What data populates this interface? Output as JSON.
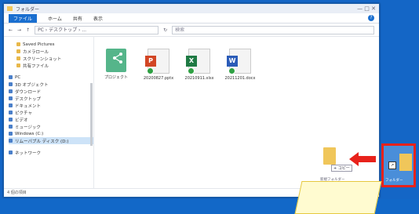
{
  "window": {
    "title": "フォルダー",
    "controls": "—  □  ✕"
  },
  "ribbon": {
    "tabs": [
      "ファイル",
      "ホーム",
      "共有",
      "表示"
    ]
  },
  "address": {
    "path": "PC › デスクトップ › ...",
    "search_placeholder": "検索"
  },
  "sidebar": {
    "items": [
      {
        "label": "Saved Pictures",
        "indent": true,
        "color": "#e8b84a"
      },
      {
        "label": "カメラロール",
        "indent": true,
        "color": "#e8b84a"
      },
      {
        "label": "スクリーンショット",
        "indent": true,
        "color": "#e8b84a"
      },
      {
        "label": "共有ファイル",
        "indent": true,
        "color": "#e8b84a"
      },
      {
        "label": "PC",
        "indent": false,
        "color": "#4a7fc9",
        "gap": true
      },
      {
        "label": "3D オブジェクト",
        "indent": false,
        "color": "#4a7fc9"
      },
      {
        "label": "ダウンロード",
        "indent": false,
        "color": "#4a7fc9"
      },
      {
        "label": "デスクトップ",
        "indent": false,
        "color": "#4a7fc9"
      },
      {
        "label": "ドキュメント",
        "indent": false,
        "color": "#4a7fc9"
      },
      {
        "label": "ピクチャ",
        "indent": false,
        "color": "#4a7fc9"
      },
      {
        "label": "ビデオ",
        "indent": false,
        "color": "#4a7fc9"
      },
      {
        "label": "ミュージック",
        "indent": false,
        "color": "#4a7fc9"
      },
      {
        "label": "Windows (C:)",
        "indent": false,
        "color": "#4a7fc9"
      },
      {
        "label": "リムーバブル ディスク (D:)",
        "indent": false,
        "color": "#4a7fc9",
        "selected": true
      },
      {
        "label": "ネットワーク",
        "indent": false,
        "color": "#4a7fc9",
        "gap": true
      }
    ]
  },
  "files": [
    {
      "name": "プロジェクト",
      "icon": "shared-folder-icon"
    },
    {
      "name": "20200827.pptx",
      "icon": "powerpoint-icon"
    },
    {
      "name": "20210911.xlsx",
      "icon": "excel-icon"
    },
    {
      "name": "20211201.docx",
      "icon": "word-icon"
    }
  ],
  "drag": {
    "tooltip": "+ コピー",
    "label": "新規フォルダー"
  },
  "desktop_icon": {
    "label": "フォルダー"
  },
  "status": {
    "text": "4 個の項目"
  },
  "colors": {
    "highlight": "#e8221b",
    "accent": "#1a6fd0"
  }
}
